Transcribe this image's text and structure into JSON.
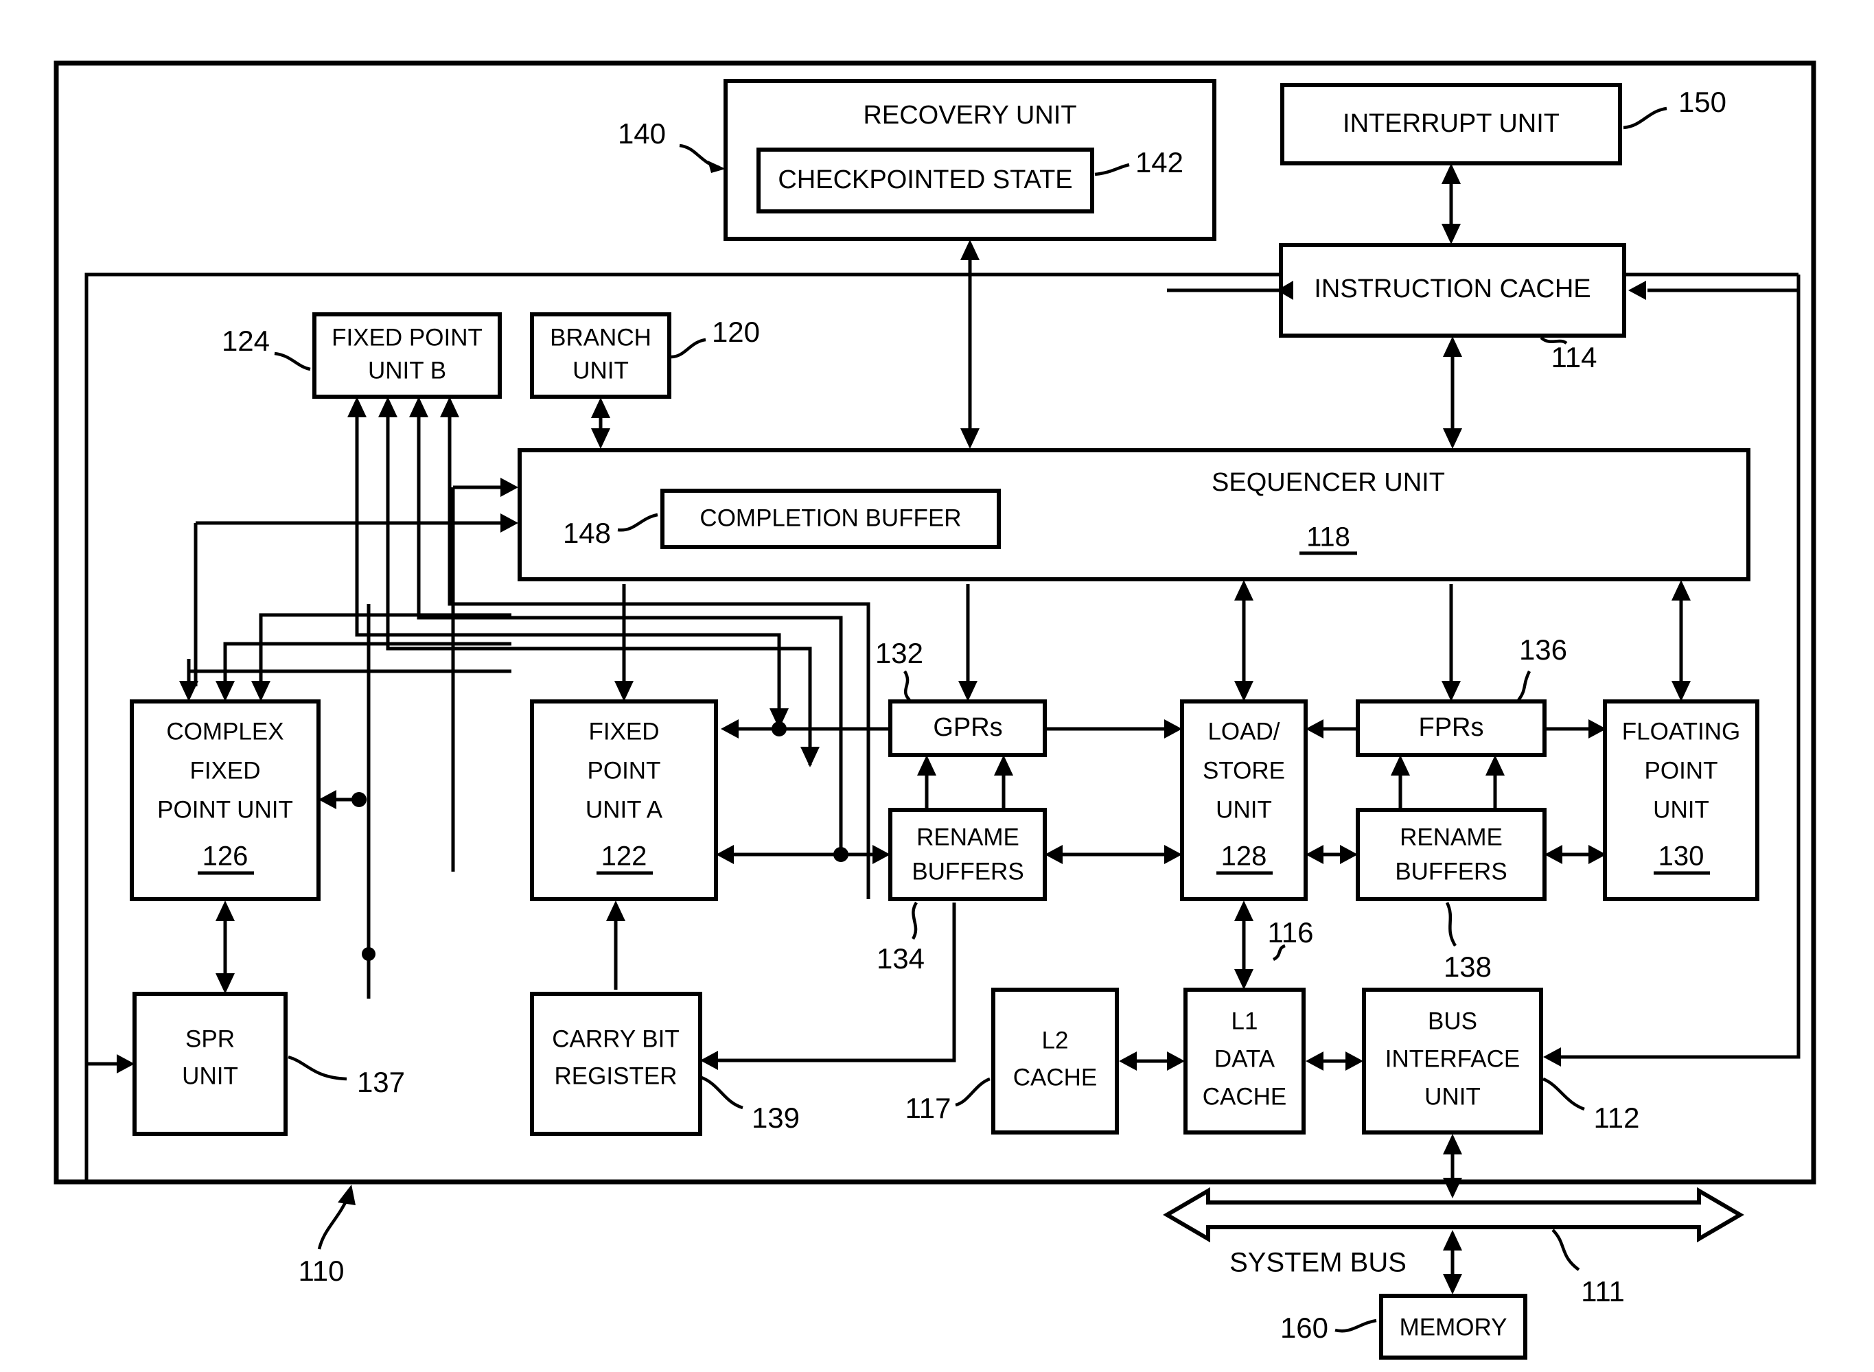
{
  "figure": {
    "type": "patent-block-diagram",
    "subject": "Superscalar processor block diagram"
  },
  "blocks": {
    "recovery_unit": {
      "label": "RECOVERY UNIT",
      "ref": "140"
    },
    "checkpointed_state": {
      "label": "CHECKPOINTED STATE",
      "ref": "142"
    },
    "interrupt_unit": {
      "label": "INTERRUPT UNIT",
      "ref": "150"
    },
    "instruction_cache": {
      "label": "INSTRUCTION CACHE",
      "ref": "114"
    },
    "fixed_point_unit_b": {
      "line1": "FIXED POINT",
      "line2": "UNIT B",
      "ref": "124"
    },
    "branch_unit": {
      "line1": "BRANCH",
      "line2": "UNIT",
      "ref": "120"
    },
    "sequencer_unit": {
      "label": "SEQUENCER UNIT",
      "number": "118"
    },
    "completion_buffer": {
      "label": "COMPLETION BUFFER",
      "ref": "148"
    },
    "complex_fixed_point_unit": {
      "line1": "COMPLEX",
      "line2": "FIXED",
      "line3": "POINT UNIT",
      "number": "126"
    },
    "fixed_point_unit_a": {
      "line1": "FIXED",
      "line2": "POINT",
      "line3": "UNIT A",
      "number": "122"
    },
    "gprs": {
      "label": "GPRs",
      "ref": "132"
    },
    "gpr_rename_buffers": {
      "line1": "RENAME",
      "line2": "BUFFERS",
      "ref": "134"
    },
    "load_store_unit": {
      "line1": "LOAD/",
      "line2": "STORE",
      "line3": "UNIT",
      "number": "128"
    },
    "fprs": {
      "label": "FPRs",
      "ref": "136"
    },
    "fpr_rename_buffers": {
      "line1": "RENAME",
      "line2": "BUFFERS",
      "ref": "138"
    },
    "floating_point_unit": {
      "line1": "FLOATING",
      "line2": "POINT",
      "line3": "UNIT",
      "number": "130"
    },
    "spr_unit": {
      "line1": "SPR",
      "line2": "UNIT",
      "ref": "137"
    },
    "carry_bit_register": {
      "line1": "CARRY BIT",
      "line2": "REGISTER",
      "ref": "139"
    },
    "l2_cache": {
      "line1": "L2",
      "line2": "CACHE",
      "ref": "117"
    },
    "l1_data_cache": {
      "line1": "L1",
      "line2": "DATA",
      "line3": "CACHE",
      "ref": "116"
    },
    "bus_interface_unit": {
      "line1": "BUS",
      "line2": "INTERFACE",
      "line3": "UNIT",
      "ref": "112"
    },
    "memory": {
      "label": "MEMORY",
      "ref": "160"
    },
    "system_bus": {
      "label": "SYSTEM BUS",
      "ref": "111"
    },
    "processor_boundary": {
      "ref": "110"
    }
  },
  "reference_numerals": [
    "110",
    "111",
    "112",
    "114",
    "116",
    "117",
    "118",
    "120",
    "122",
    "124",
    "126",
    "128",
    "130",
    "132",
    "134",
    "136",
    "137",
    "138",
    "139",
    "140",
    "142",
    "148",
    "150",
    "160"
  ],
  "colors": {
    "line": "#000000",
    "fill": "#ffffff",
    "text": "#000000"
  }
}
